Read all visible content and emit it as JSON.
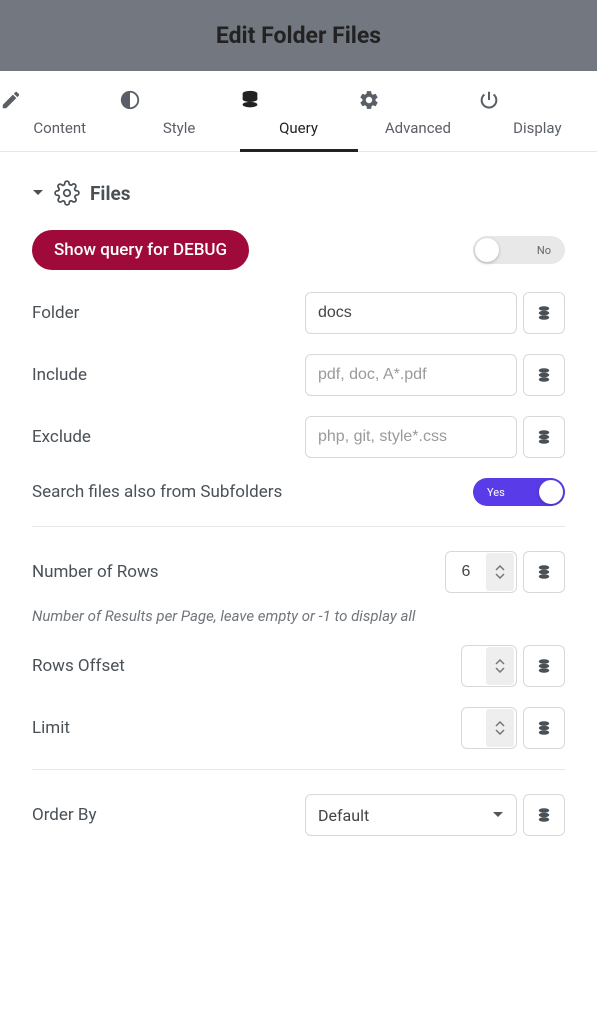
{
  "header": {
    "title": "Edit Folder Files"
  },
  "tabs": {
    "content": "Content",
    "style": "Style",
    "query": "Query",
    "advanced": "Advanced",
    "display": "Display"
  },
  "section": {
    "title": "Files"
  },
  "debug": {
    "label": "Show query for DEBUG",
    "state": "No"
  },
  "fields": {
    "folder": {
      "label": "Folder",
      "value": "docs"
    },
    "include": {
      "label": "Include",
      "placeholder": "pdf, doc, A*.pdf"
    },
    "exclude": {
      "label": "Exclude",
      "placeholder": "php, git, style*.css"
    },
    "subfolders": {
      "label": "Search files also from Subfolders",
      "state": "Yes"
    },
    "rows": {
      "label": "Number of Rows",
      "value": "6",
      "helper": "Number of Results per Page, leave empty or -1 to display all"
    },
    "offset": {
      "label": "Rows Offset",
      "value": ""
    },
    "limit": {
      "label": "Limit",
      "value": ""
    },
    "orderby": {
      "label": "Order By",
      "value": "Default"
    }
  }
}
